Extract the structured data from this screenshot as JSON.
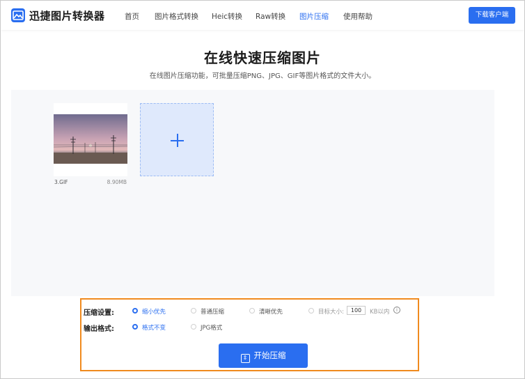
{
  "header": {
    "brand": "迅捷图片转换器",
    "nav": [
      {
        "label": "首页"
      },
      {
        "label": "图片格式转换"
      },
      {
        "label": "Heic转换"
      },
      {
        "label": "Raw转换"
      },
      {
        "label": "图片压缩",
        "active": true
      },
      {
        "label": "使用帮助"
      }
    ],
    "download_label": "下载客户端"
  },
  "hero": {
    "title": "在线快速压缩图片",
    "subtitle": "在线图片压缩功能，可批量压缩PNG、JPG、GIF等图片格式的文件大小。"
  },
  "upload": {
    "files": [
      {
        "name": "3.GIF",
        "size": "8.90MB"
      }
    ],
    "add_icon": "plus-icon"
  },
  "settings": {
    "compress_label": "压缩设置:",
    "compress_options": [
      {
        "label": "缩小优先",
        "selected": true
      },
      {
        "label": "普通压缩",
        "selected": false
      },
      {
        "label": "清晰优先",
        "selected": false
      },
      {
        "label": "目标大小:",
        "selected": false
      }
    ],
    "target_size_value": "100",
    "target_size_unit": "KB以内",
    "output_label": "输出格式:",
    "output_options": [
      {
        "label": "格式不变",
        "selected": true
      },
      {
        "label": "JPG格式",
        "selected": false
      }
    ],
    "start_label": "开始压缩"
  },
  "colors": {
    "accent": "#2a6ef0",
    "highlight_border": "#f08a1e"
  }
}
